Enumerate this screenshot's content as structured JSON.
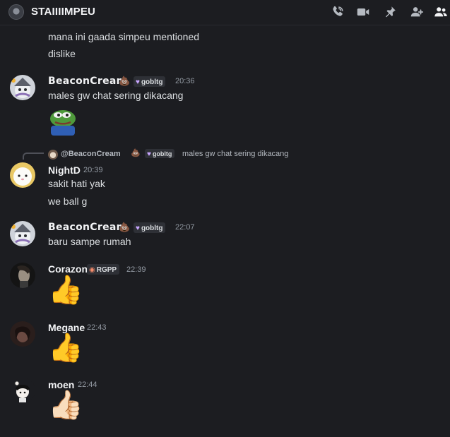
{
  "header": {
    "channel_name": "STAIIIIMPEU",
    "icons": [
      "phone-call-icon",
      "video-call-icon",
      "pin-icon",
      "add-member-icon",
      "member-list-icon"
    ]
  },
  "messages": {
    "m0": {
      "line1": "mana ini gaada simpeu mentioned",
      "line2": "dislike"
    },
    "m1": {
      "author": "BeaconCream",
      "emoji": "💩",
      "tag": "gobltg",
      "time": "20:36",
      "text": "males gw chat sering dikacang",
      "sticker": "pepe-frog-sticker"
    },
    "m2": {
      "reply": {
        "author": "@BeaconCream",
        "emoji": "💩",
        "tag": "gobltg",
        "text": "males gw chat sering dikacang"
      },
      "author": "NightD",
      "time": "20:39",
      "line1": "sakit hati yak",
      "line2": "we ball g"
    },
    "m3": {
      "author": "BeaconCream",
      "emoji": "💩",
      "tag": "gobltg",
      "time": "22:07",
      "text": "baru sampe rumah"
    },
    "m4": {
      "author": "Corazon",
      "tag": "RGPP",
      "time": "22:39",
      "emoji": "👍"
    },
    "m5": {
      "author": "Megane",
      "time": "22:43",
      "emoji": "👍"
    },
    "m6": {
      "author": "moen",
      "time": "22:44",
      "emoji": "👍🏻"
    }
  },
  "colors": {
    "background": "#1c1d21",
    "text": "#dbdee1",
    "muted": "#949ba4",
    "tag_bg": "#2e3036"
  }
}
